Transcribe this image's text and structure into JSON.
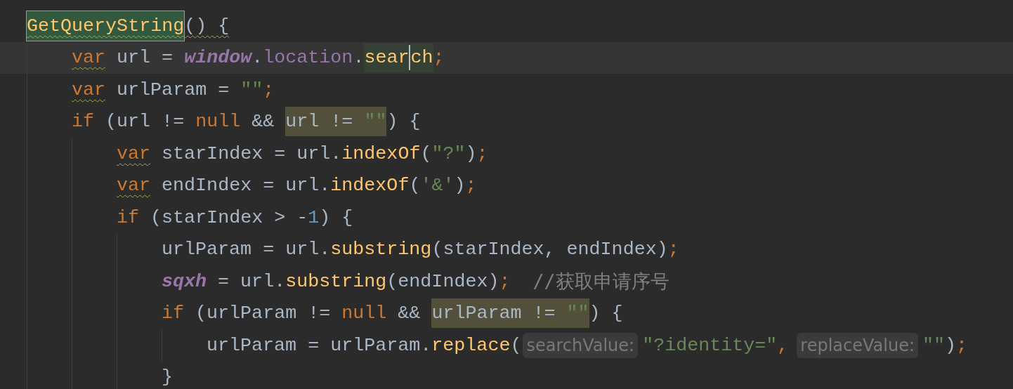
{
  "editor": {
    "lines": [
      {
        "tokens": [
          {
            "text": "GetQueryString",
            "kind": "method",
            "declaration_highlight": true,
            "warning": true
          },
          {
            "text": "() {",
            "kind": "plain",
            "warning": true
          }
        ],
        "children": [
          {
            "current": true,
            "tokens": [
              {
                "text": "var",
                "kind": "keyword",
                "warning": true
              },
              {
                "text": " url = ",
                "kind": "plain"
              },
              {
                "text": "window",
                "kind": "global"
              },
              {
                "text": ".",
                "kind": "plain"
              },
              {
                "text": "location",
                "kind": "property"
              },
              {
                "text": ".",
                "kind": "plain"
              },
              {
                "text": "sear",
                "kind": "method",
                "read_highlight": true
              },
              {
                "text": "ch",
                "kind": "method",
                "read_highlight": true,
                "caret": true
              },
              {
                "text": ";",
                "kind": "punct"
              }
            ]
          },
          {
            "tokens": [
              {
                "text": "var",
                "kind": "keyword",
                "warning": true
              },
              {
                "text": " urlParam = ",
                "kind": "plain"
              },
              {
                "text": "\"\"",
                "kind": "string"
              },
              {
                "text": ";",
                "kind": "punct"
              }
            ]
          },
          {
            "tokens": [
              {
                "text": "if",
                "kind": "keyword"
              },
              {
                "text": " (url != ",
                "kind": "plain"
              },
              {
                "text": "null",
                "kind": "keyword"
              },
              {
                "text": " && ",
                "kind": "plain"
              },
              {
                "text": "url != ",
                "kind": "plain",
                "usage_highlight": true
              },
              {
                "text": "\"\"",
                "kind": "string",
                "usage_highlight": true
              },
              {
                "text": ") {",
                "kind": "plain"
              }
            ],
            "children": [
              {
                "tokens": [
                  {
                    "text": "var",
                    "kind": "keyword",
                    "warning": true
                  },
                  {
                    "text": " starIndex = url.",
                    "kind": "plain"
                  },
                  {
                    "text": "indexOf",
                    "kind": "method"
                  },
                  {
                    "text": "(",
                    "kind": "plain"
                  },
                  {
                    "text": "\"?\"",
                    "kind": "string"
                  },
                  {
                    "text": ")",
                    "kind": "plain"
                  },
                  {
                    "text": ";",
                    "kind": "punct"
                  }
                ]
              },
              {
                "tokens": [
                  {
                    "text": "var",
                    "kind": "keyword",
                    "warning": true
                  },
                  {
                    "text": " endIndex = url.",
                    "kind": "plain"
                  },
                  {
                    "text": "indexOf",
                    "kind": "method"
                  },
                  {
                    "text": "(",
                    "kind": "plain"
                  },
                  {
                    "text": "'&'",
                    "kind": "string"
                  },
                  {
                    "text": ")",
                    "kind": "plain"
                  },
                  {
                    "text": ";",
                    "kind": "punct"
                  }
                ]
              },
              {
                "tokens": [
                  {
                    "text": "if",
                    "kind": "keyword"
                  },
                  {
                    "text": " (starIndex > -",
                    "kind": "plain"
                  },
                  {
                    "text": "1",
                    "kind": "number"
                  },
                  {
                    "text": ") {",
                    "kind": "plain"
                  }
                ],
                "children": [
                  {
                    "tokens": [
                      {
                        "text": "urlParam = url.",
                        "kind": "plain"
                      },
                      {
                        "text": "substring",
                        "kind": "method"
                      },
                      {
                        "text": "(starIndex, endIndex)",
                        "kind": "plain"
                      },
                      {
                        "text": ";",
                        "kind": "punct"
                      }
                    ]
                  },
                  {
                    "tokens": [
                      {
                        "text": "sqxh",
                        "kind": "global"
                      },
                      {
                        "text": " = url.",
                        "kind": "plain"
                      },
                      {
                        "text": "substring",
                        "kind": "method"
                      },
                      {
                        "text": "(endIndex)",
                        "kind": "plain"
                      },
                      {
                        "text": ";",
                        "kind": "punct"
                      },
                      {
                        "text": "//获取申请序号",
                        "kind": "comment"
                      }
                    ]
                  },
                  {
                    "tokens": [
                      {
                        "text": "if",
                        "kind": "keyword"
                      },
                      {
                        "text": " (urlParam != ",
                        "kind": "plain"
                      },
                      {
                        "text": "null",
                        "kind": "keyword"
                      },
                      {
                        "text": " && ",
                        "kind": "plain"
                      },
                      {
                        "text": "urlParam != ",
                        "kind": "plain",
                        "usage_highlight": true
                      },
                      {
                        "text": "\"\"",
                        "kind": "string",
                        "usage_highlight": true
                      },
                      {
                        "text": ") {",
                        "kind": "plain"
                      }
                    ],
                    "children": [
                      {
                        "tokens": [
                          {
                            "text": "urlParam = urlParam.",
                            "kind": "plain"
                          },
                          {
                            "text": "replace",
                            "kind": "method"
                          },
                          {
                            "text": "(",
                            "kind": "plain"
                          },
                          {
                            "text": "searchValue:",
                            "kind": "hint"
                          },
                          {
                            "text": "\"?identity=\"",
                            "kind": "string"
                          },
                          {
                            "text": ",",
                            "kind": "punct"
                          },
                          {
                            "text": "replaceValue:",
                            "kind": "hint"
                          },
                          {
                            "text": "\"\"",
                            "kind": "string"
                          },
                          {
                            "text": ")",
                            "kind": "plain"
                          },
                          {
                            "text": ";",
                            "kind": "punct"
                          }
                        ]
                      }
                    ]
                  },
                  {
                    "tokens": [
                      {
                        "text": "}",
                        "kind": "plain"
                      }
                    ]
                  }
                ]
              }
            ]
          }
        ]
      }
    ]
  }
}
